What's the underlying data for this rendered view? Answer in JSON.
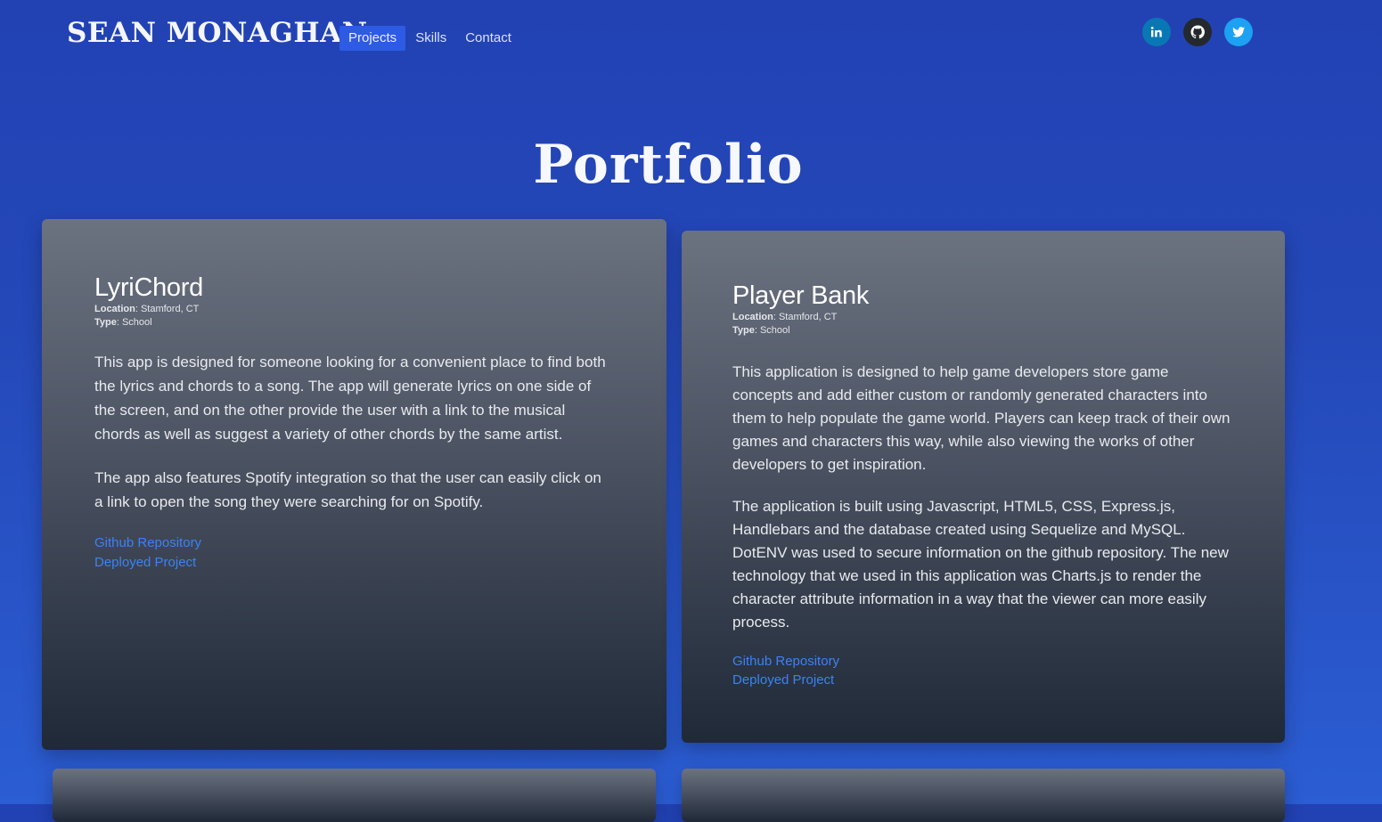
{
  "header": {
    "brand": "SEAN MONAGHAN",
    "nav": [
      {
        "label": "Projects",
        "active": true
      },
      {
        "label": "Skills",
        "active": false
      },
      {
        "label": "Contact",
        "active": false
      }
    ],
    "social": [
      {
        "name": "linkedin",
        "icon": "linkedin-icon",
        "color": "#0a77b5"
      },
      {
        "name": "github",
        "icon": "github-icon",
        "color": "#24292e"
      },
      {
        "name": "twitter",
        "icon": "twitter-icon",
        "color": "#1da1f2"
      }
    ]
  },
  "main": {
    "title": "Portfolio",
    "projects": [
      {
        "title": "LyriChord",
        "location_label": "Location",
        "location": ": Stamford, CT",
        "type_label": "Type",
        "type": ": School",
        "paragraphs": [
          "This app is designed for someone looking for a convenient place to find both the lyrics and chords to a song. The app will generate lyrics on one side of the screen, and on the other provide the user with a link to the musical chords as well as suggest a variety of other chords by the same artist.",
          "The app also features Spotify integration so that the user can easily click on a link to open the song they were searching for on Spotify."
        ],
        "links": [
          "Github Repository",
          "Deployed Project"
        ]
      },
      {
        "title": "Player Bank",
        "location_label": "Location",
        "location": ": Stamford, CT",
        "type_label": "Type",
        "type": ": School",
        "paragraphs": [
          "This application is designed to help game developers store game concepts and add either custom or randomly generated characters into them to help populate the game world. Players can keep track of their own games and characters this way, while also viewing the works of other developers to get inspiration.",
          "The application is built using Javascript, HTML5, CSS, Express.js, Handlebars and the database created using Sequelize and MySQL. DotENV was used to secure information on the github repository. The new technology that we used in this application was Charts.js to render the character attribute information in a way that the viewer can more easily process."
        ],
        "links": [
          "Github Repository",
          "Deployed Project"
        ]
      }
    ]
  },
  "colors": {
    "background": "#2242b4",
    "active_nav": "#2d5be3",
    "link": "#3b82f6",
    "card_top": "#6b7280",
    "card_bottom": "#1f2937"
  }
}
